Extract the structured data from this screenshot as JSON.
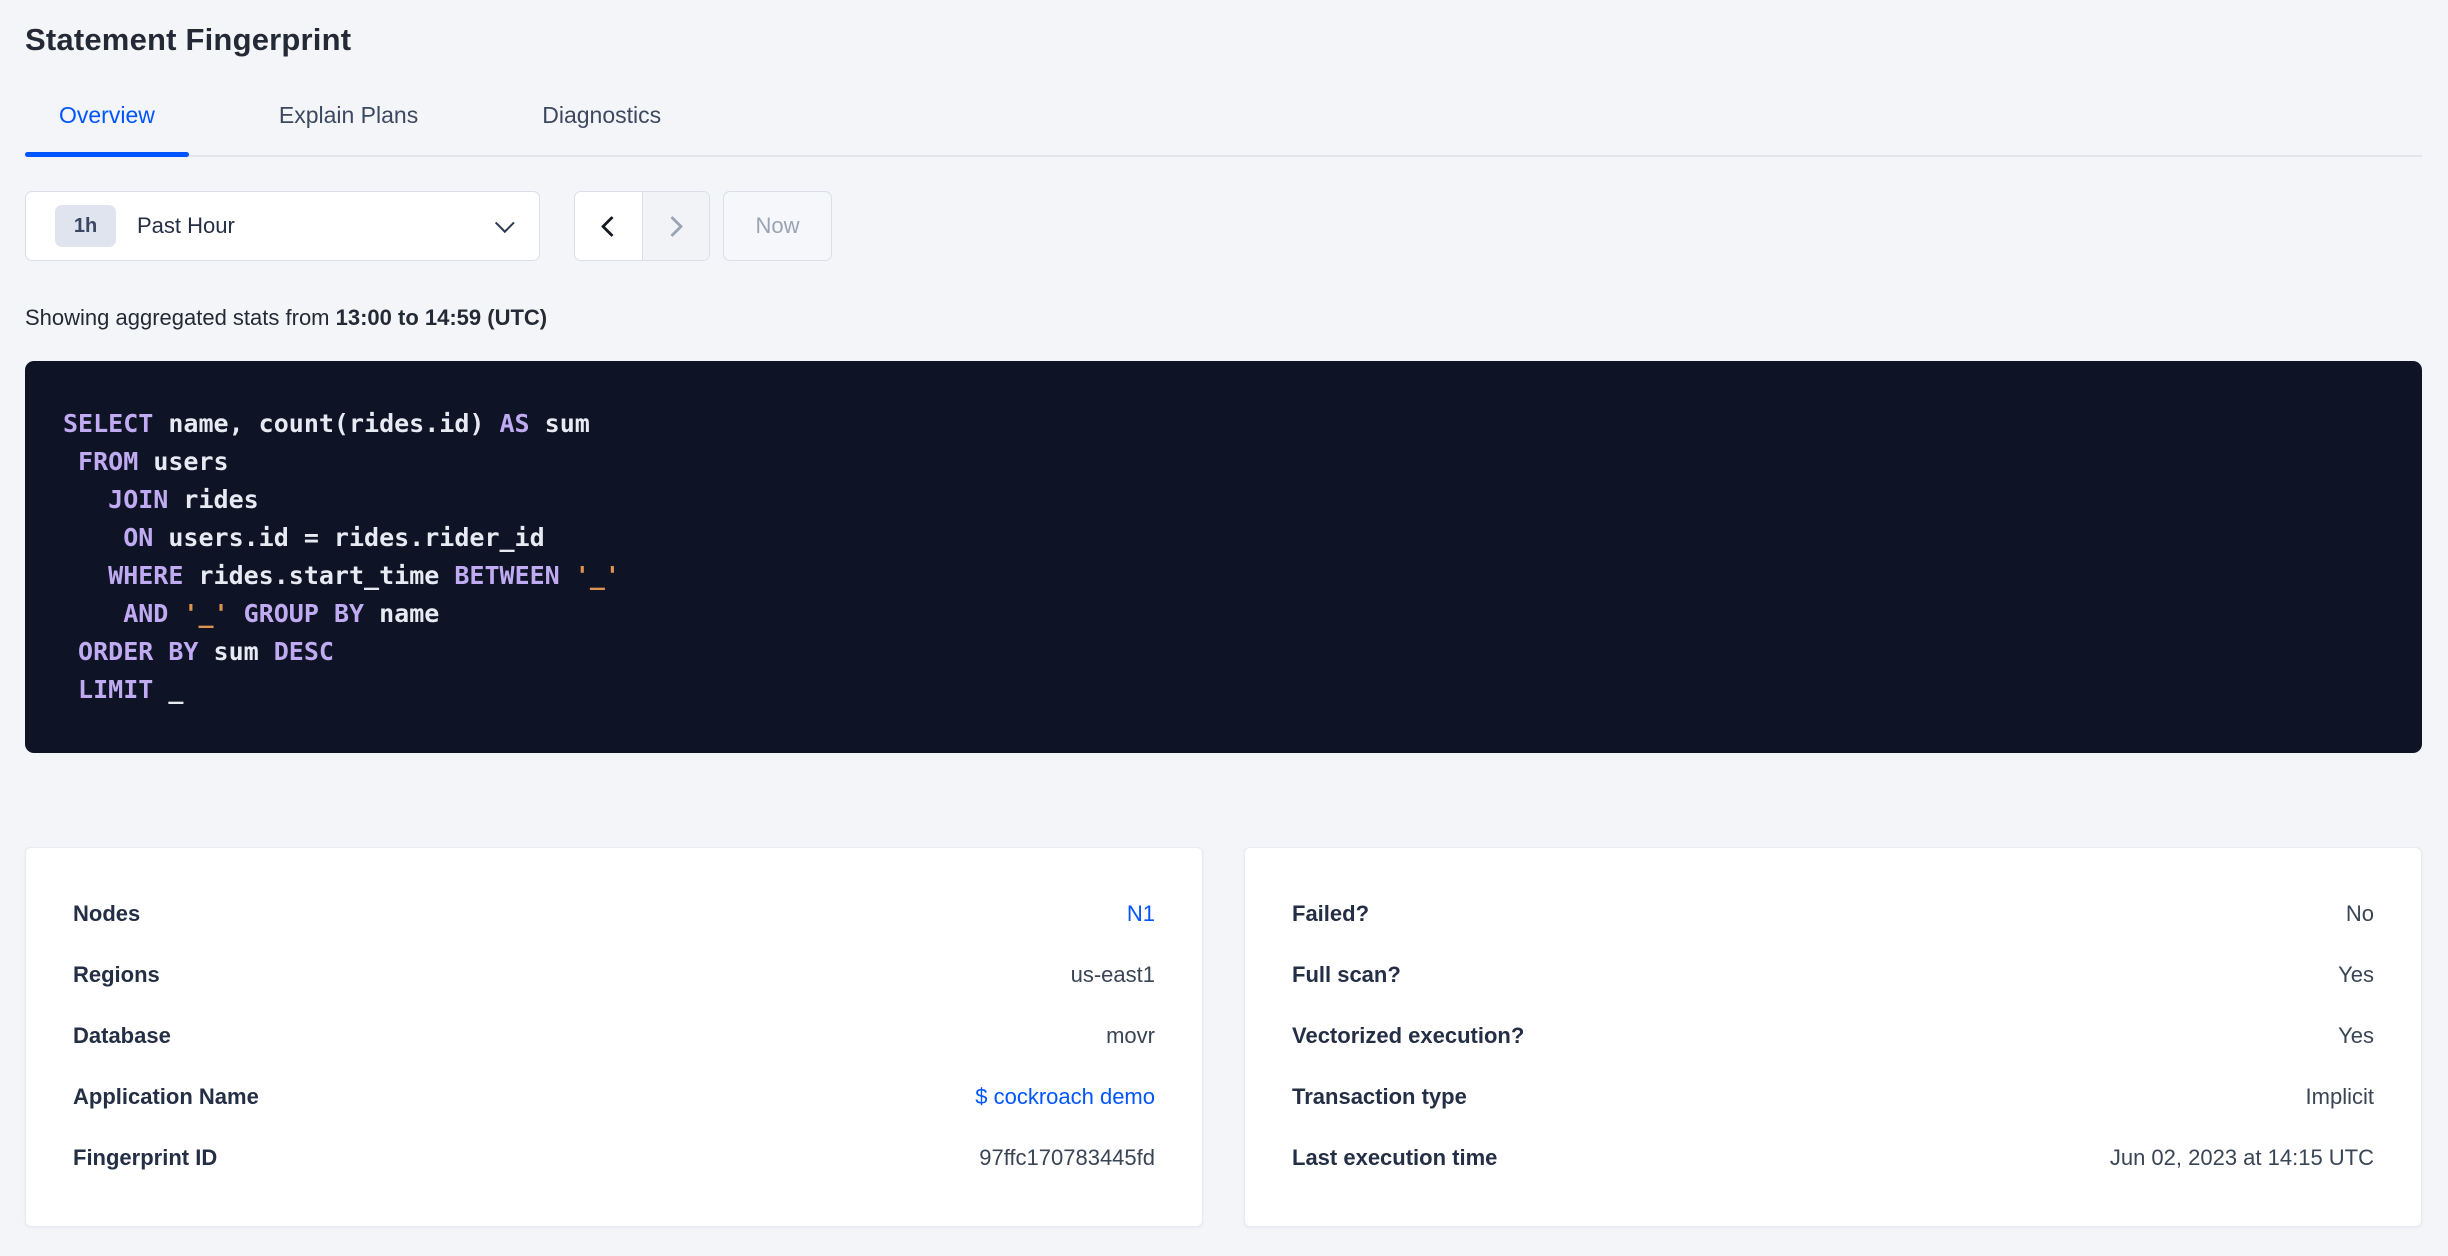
{
  "page": {
    "title": "Statement Fingerprint"
  },
  "tabs": [
    {
      "label": "Overview",
      "active": true
    },
    {
      "label": "Explain Plans",
      "active": false
    },
    {
      "label": "Diagnostics",
      "active": false
    }
  ],
  "time_controls": {
    "interval_badge": "1h",
    "interval_label": "Past Hour",
    "now_label": "Now"
  },
  "stats_caption": {
    "prefix": "Showing aggregated stats from ",
    "range": "13:00 to 14:59 (UTC)"
  },
  "sql": {
    "lines": [
      [
        [
          "kw",
          "SELECT"
        ],
        [
          "pl",
          " name, count(rides.id) "
        ],
        [
          "kw",
          "AS"
        ],
        [
          "pl",
          " sum"
        ]
      ],
      [
        [
          "kw",
          " FROM"
        ],
        [
          "pl",
          " users"
        ]
      ],
      [
        [
          "kw",
          "   JOIN"
        ],
        [
          "pl",
          " rides"
        ]
      ],
      [
        [
          "kw",
          "    ON"
        ],
        [
          "pl",
          " users.id = rides.rider_id"
        ]
      ],
      [
        [
          "kw",
          "   WHERE"
        ],
        [
          "pl",
          " rides.start_time "
        ],
        [
          "kw",
          "BETWEEN"
        ],
        [
          "pl",
          " "
        ],
        [
          "str",
          "'_'"
        ]
      ],
      [
        [
          "kw",
          "    AND"
        ],
        [
          "pl",
          " "
        ],
        [
          "str",
          "'_'"
        ],
        [
          "pl",
          " "
        ],
        [
          "kw",
          "GROUP BY"
        ],
        [
          "pl",
          " name"
        ]
      ],
      [
        [
          "kw",
          " ORDER BY"
        ],
        [
          "pl",
          " sum "
        ],
        [
          "kw",
          "DESC"
        ]
      ],
      [
        [
          "kw",
          " LIMIT"
        ],
        [
          "pl",
          " _"
        ]
      ]
    ]
  },
  "cards": {
    "left": {
      "rows": [
        {
          "label": "Nodes",
          "value": "N1",
          "link": true
        },
        {
          "label": "Regions",
          "value": "us-east1",
          "link": false
        },
        {
          "label": "Database",
          "value": "movr",
          "link": false
        },
        {
          "label": "Application Name",
          "value": "$ cockroach demo",
          "link": true
        },
        {
          "label": "Fingerprint ID",
          "value": "97ffc170783445fd",
          "link": false
        }
      ]
    },
    "right": {
      "rows": [
        {
          "label": "Failed?",
          "value": "No",
          "link": false
        },
        {
          "label": "Full scan?",
          "value": "Yes",
          "link": false
        },
        {
          "label": "Vectorized execution?",
          "value": "Yes",
          "link": false
        },
        {
          "label": "Transaction type",
          "value": "Implicit",
          "link": false
        },
        {
          "label": "Last execution time",
          "value": "Jun 02, 2023 at 14:15 UTC",
          "link": false
        }
      ]
    }
  },
  "colors": {
    "accent_blue": "#0055ff",
    "sql_background": "#0e1425",
    "sql_keyword": "#c0abf2",
    "sql_plain": "#e8eaf3",
    "sql_string": "#dd9450"
  }
}
